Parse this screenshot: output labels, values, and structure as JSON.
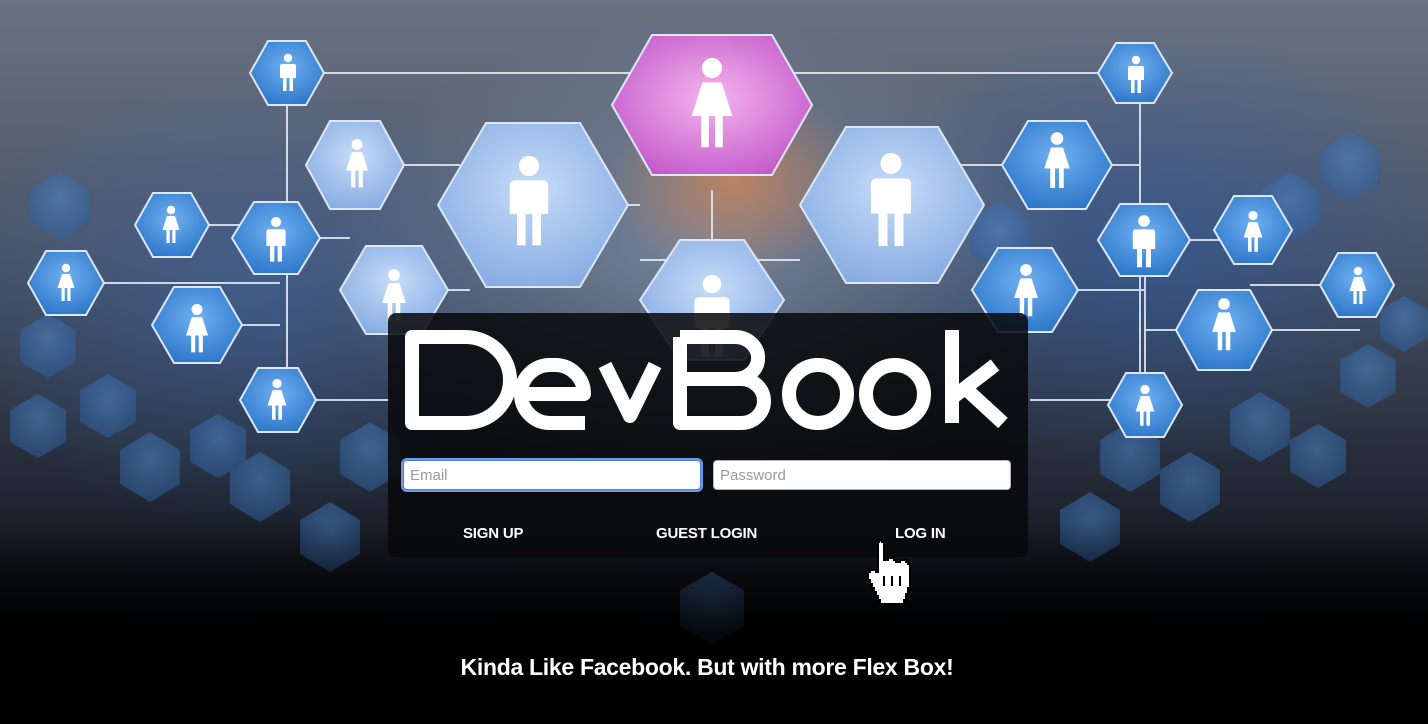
{
  "app": {
    "logo_text": "DevBook"
  },
  "login_form": {
    "email_placeholder": "Email",
    "password_placeholder": "Password",
    "email_value": "",
    "password_value": ""
  },
  "actions": {
    "signup_label": "SIGN UP",
    "guest_label": "GUEST LOGIN",
    "login_label": "LOG IN"
  },
  "tagline": "Kinda Like Facebook. But with more Flex Box!",
  "background": {
    "description_icons": [
      "person-male-icon",
      "person-female-icon"
    ],
    "hex_color": "#3a86d8",
    "hex_highlight_color": "#e37ad6"
  }
}
